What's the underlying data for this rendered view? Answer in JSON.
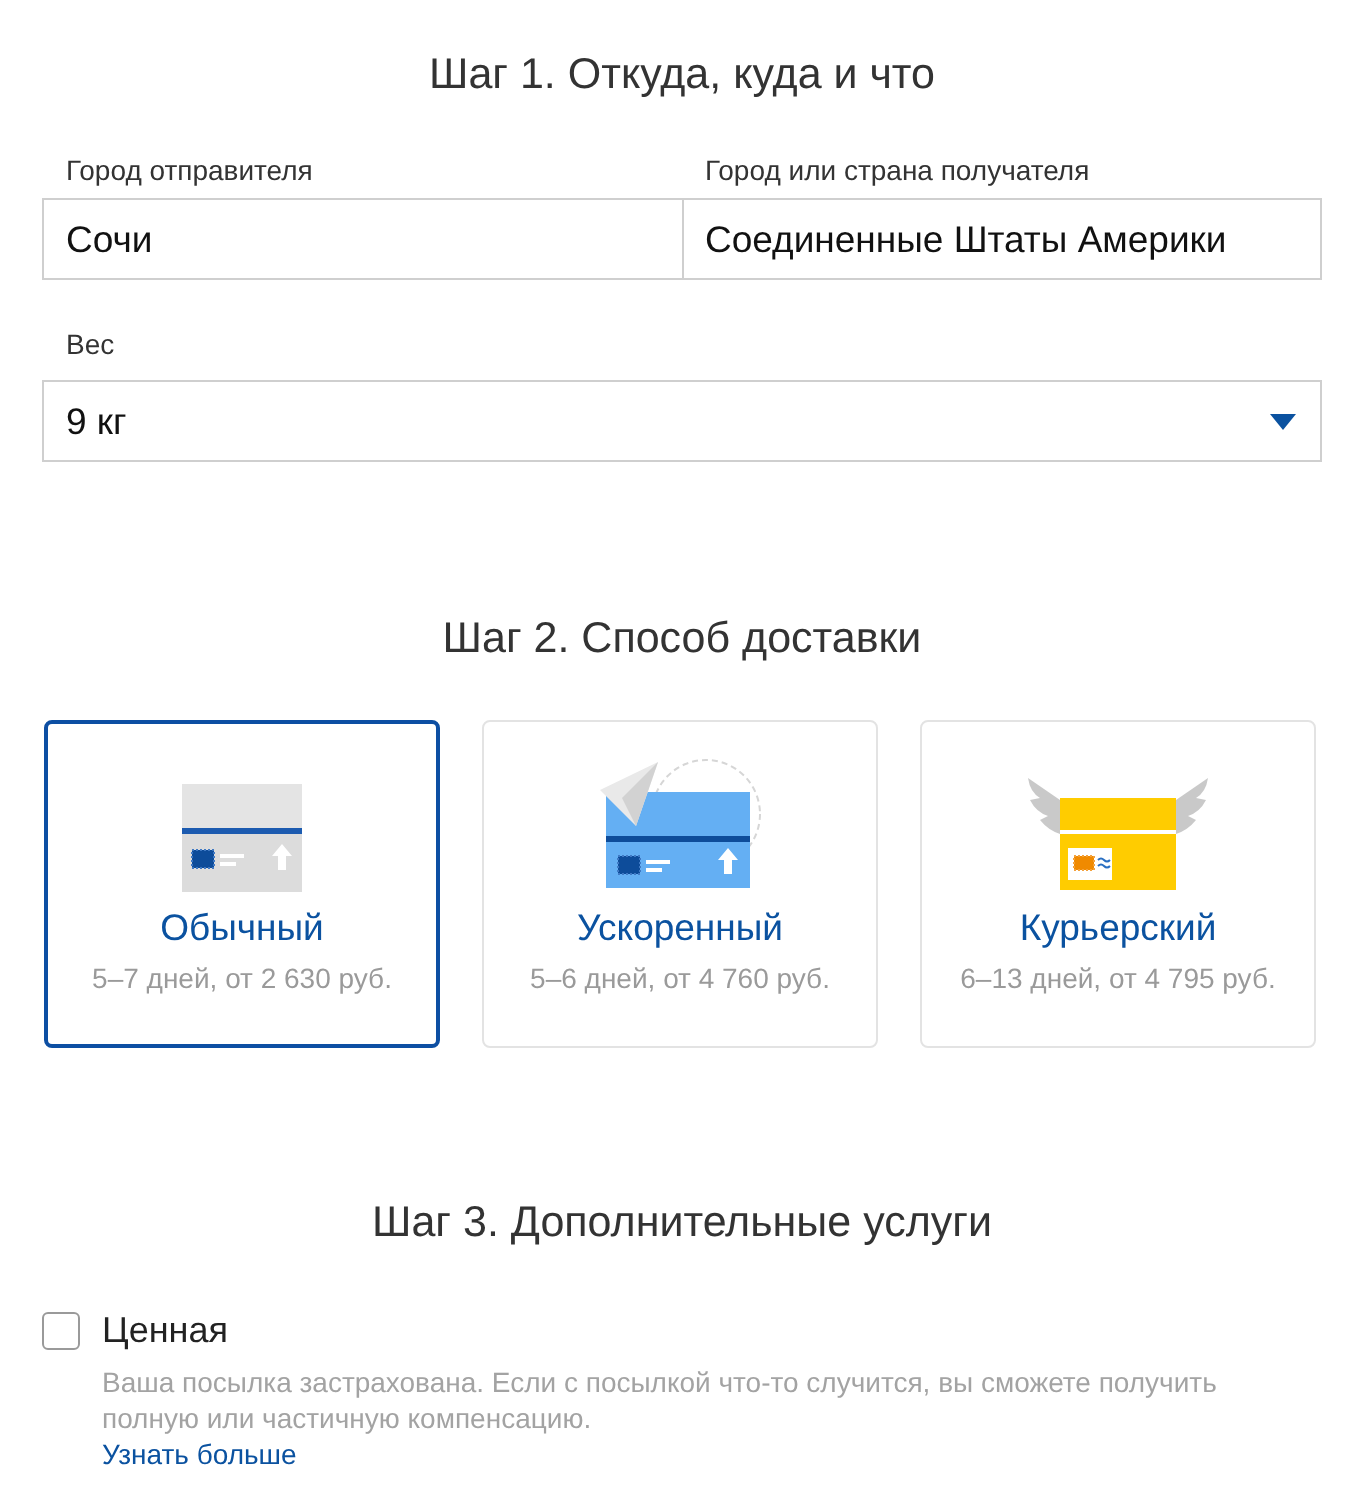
{
  "step1": {
    "heading": "Шаг 1. Откуда, куда и что",
    "fields": [
      {
        "label": "Город отправителя",
        "value": "Сочи"
      },
      {
        "label": "Город или страна получателя",
        "value": "Соединенные Штаты Америки"
      }
    ],
    "weight": {
      "label": "Вес",
      "value": "9 кг"
    }
  },
  "step2": {
    "heading": "Шаг 2. Способ доставки",
    "options": [
      {
        "kind": "standard",
        "title": "Обычный",
        "details": "5–7 дней, от 2 630 руб.",
        "selected": true
      },
      {
        "kind": "express",
        "title": "Ускоренный",
        "details": "5–6 дней, от 4 760 руб.",
        "selected": false
      },
      {
        "kind": "courier",
        "title": "Курьерский",
        "details": "6–13 дней, от 4 795 руб.",
        "selected": false
      }
    ]
  },
  "step3": {
    "heading": "Шаг 3. Дополнительные услуги",
    "services": [
      {
        "label": "Ценная",
        "checked": false,
        "description": "Ваша посылка застрахована. Если с посылкой что-то случится, вы сможете получить полную или частичную компенсацию.",
        "link": "Узнать больше"
      }
    ]
  }
}
